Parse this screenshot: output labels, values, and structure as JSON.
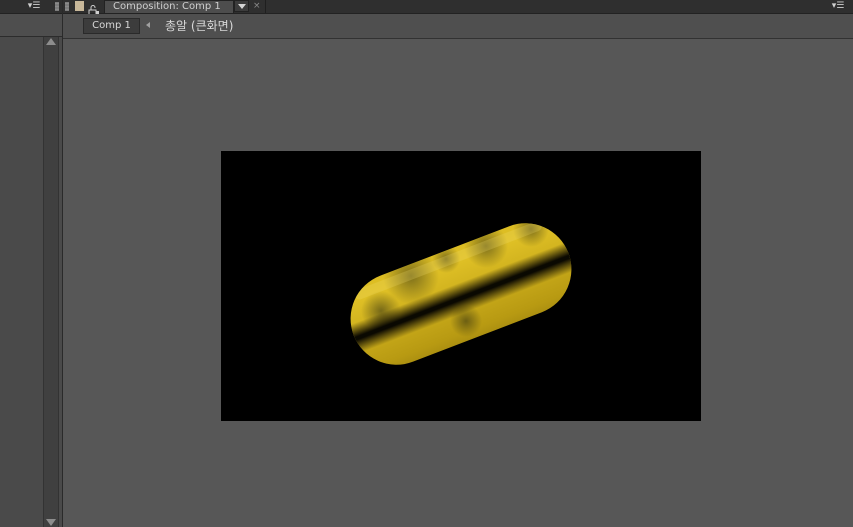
{
  "left_panel": {
    "menu_icon": "panel-menu-icon"
  },
  "composition_panel": {
    "tab": {
      "label": "Composition: Comp 1",
      "close_glyph": "×",
      "dropdown_icon": "dropdown-arrow-icon",
      "swatch_color": "#c8b89a"
    },
    "menu_icon": "panel-menu-icon",
    "nav": {
      "comp_button_label": "Comp 1",
      "layer_label": "총알 (큰화면)"
    },
    "viewer": {
      "canvas_background": "#000000",
      "object": "yellow-capsule-bullet"
    }
  },
  "colors": {
    "panel_bg": "#575757",
    "tabbar_bg": "#2f2f2f",
    "object_yellow": "#d4b61c"
  }
}
